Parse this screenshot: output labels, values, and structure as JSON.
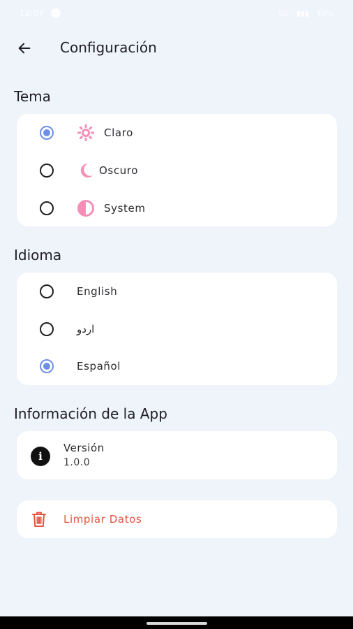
{
  "status_bar": {
    "time": "12:07 ",
    "right_text": "5G  ·  ▮▮▮  ·  40%"
  },
  "header": {
    "title": "Configuración",
    "back_icon": "arrow-left-icon"
  },
  "theme": {
    "section_title": "Tema",
    "options": [
      {
        "label": "Claro",
        "icon": "sun-icon",
        "selected": true
      },
      {
        "label": "Oscuro",
        "icon": "moon-icon",
        "selected": false
      },
      {
        "label": "System",
        "icon": "half-circle-icon",
        "selected": false
      }
    ],
    "icon_color": "#f48fb8"
  },
  "language": {
    "section_title": "Idioma",
    "options": [
      {
        "label": "English",
        "selected": false
      },
      {
        "label": "اردو",
        "selected": false
      },
      {
        "label": "Español",
        "selected": true
      }
    ]
  },
  "app_info": {
    "section_title": "Información de la App",
    "version_label": "Versión",
    "version_value": "1.0.0",
    "icon": "info-icon"
  },
  "clear_data": {
    "label": "Limpiar Datos",
    "icon": "trash-icon",
    "color": "#e2553f"
  },
  "colors": {
    "background": "#eff3fa",
    "accent": "#6d8fe6",
    "card": "#ffffff"
  }
}
